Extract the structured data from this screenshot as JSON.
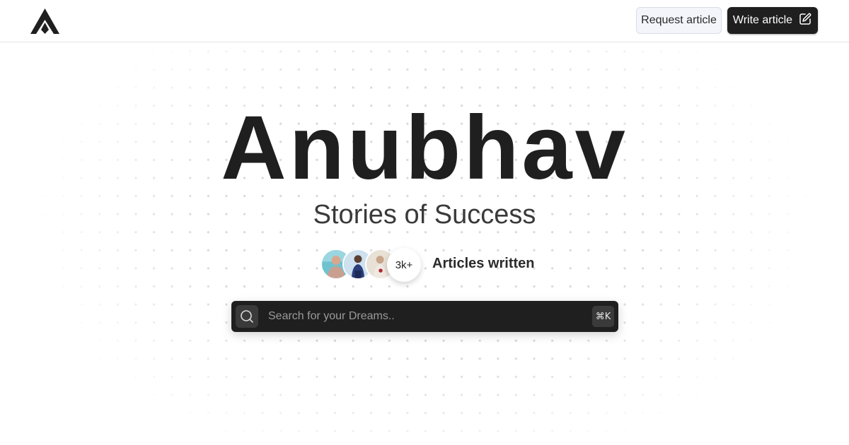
{
  "header": {
    "logo_icon": "mountain-a-logo",
    "request_label": "Request article",
    "write_label": "Write article",
    "write_icon": "edit-icon"
  },
  "hero": {
    "title": "Anubhav",
    "subtitle": "Stories of Success",
    "articles_count": "3k+",
    "articles_label": "Articles written",
    "avatars": [
      "avatar-man-teal",
      "avatar-man-blue",
      "avatar-woman-roses"
    ]
  },
  "search": {
    "placeholder": "Search for your Dreams..",
    "shortcut": "⌘K",
    "icon": "search-icon"
  },
  "colors": {
    "text": "#1f1f1f",
    "dark_button": "#1f1f1f",
    "light_button": "#f3f5fa",
    "dot_grid": "#d9d9d9"
  }
}
